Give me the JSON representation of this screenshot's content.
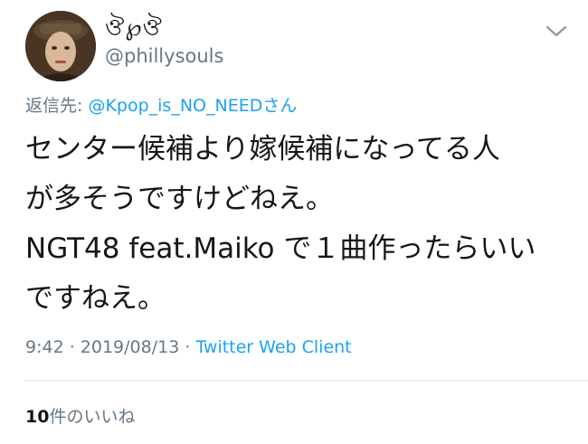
{
  "tweet": {
    "display_name": "ঔ℘ঔ",
    "handle": "@phillysouls",
    "reply_prefix": "返信先: ",
    "reply_mention": "@Kpop_is_NO_NEED",
    "reply_suffix": "さん",
    "text_lines": [
      "センター候補より嫁候補になってる人",
      "が多そうですけどねえ。",
      "NGT48 feat.Maiko で１曲作ったらいい",
      "ですねえ。"
    ],
    "time": "9:42",
    "separator": " · ",
    "date": "2019/08/13",
    "source": "Twitter Web Client",
    "like_count": "10",
    "like_label": "件のいいね"
  },
  "icons": {
    "avatar": "profile-photo",
    "menu": "chevron-down-icon"
  },
  "colors": {
    "text": "#14171a",
    "secondary": "#657786",
    "link": "#1da1f2",
    "divider": "#e1e8ed"
  }
}
